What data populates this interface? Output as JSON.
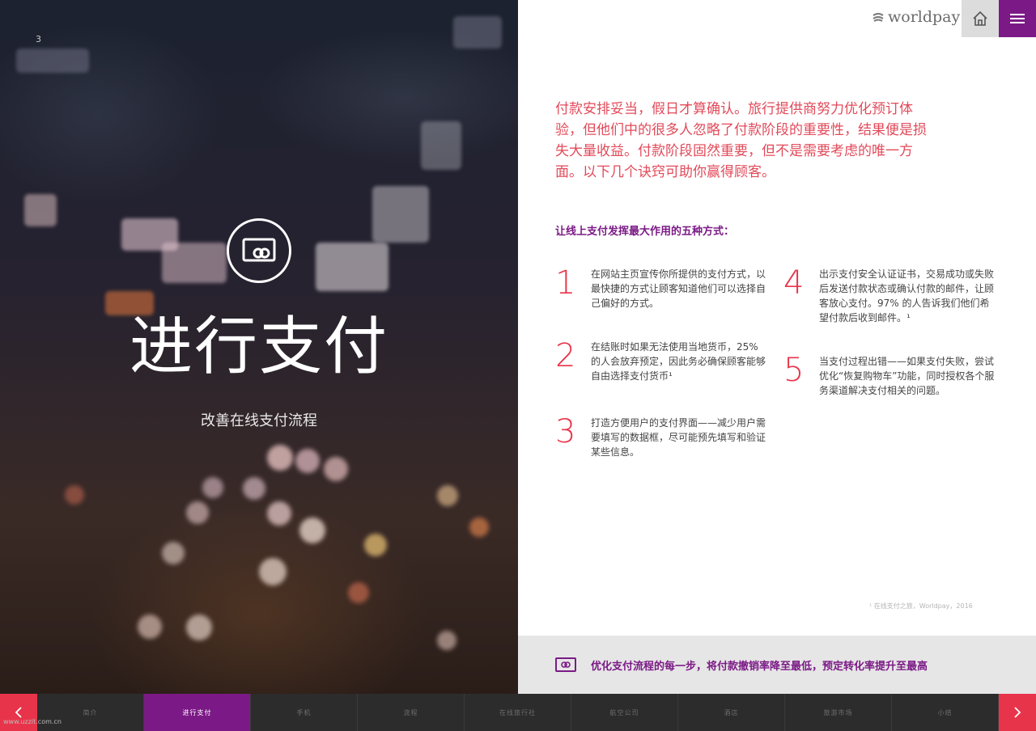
{
  "left_panel": {
    "page_number": "3",
    "hero_title": "进行支付",
    "hero_subtitle": "改善在线支付流程",
    "hero_icon": "payment-card-icon"
  },
  "header": {
    "logo_text": "worldpay",
    "home_icon": "home-icon",
    "menu_icon": "hamburger-menu-icon"
  },
  "content": {
    "intro": "付款安排妥当，假日才算确认。旅行提供商努力优化预订体验，但他们中的很多人忽略了付款阶段的重要性，结果便是损失大量收益。付款阶段固然重要，但不是需要考虑的唯一方面。以下几个诀窍可助你赢得顾客。",
    "subhead": "让线上支付发挥最大作用的五种方式：",
    "tips": [
      {
        "num": "1",
        "text": "在网站主页宣传你所提供的支付方式，以最快捷的方式让顾客知道他们可以选择自己偏好的方式。"
      },
      {
        "num": "2",
        "text": "在结账时如果无法使用当地货币，25% 的人会放弃预定，因此务必确保顾客能够自由选择支付货币¹"
      },
      {
        "num": "3",
        "text": "打造方便用户的支付界面——减少用户需要填写的数据框，尽可能预先填写和验证某些信息。"
      },
      {
        "num": "4",
        "text": "出示支付安全认证证书，交易成功或失败后发送付款状态或确认付款的邮件，让顾客放心支付。97% 的人告诉我们他们希望付款后收到邮件。¹"
      },
      {
        "num": "5",
        "text": "当支付过程出错——如果支付失败，尝试优化“恢复购物车”功能，同时授权各个服务渠道解决支付相关的问题。"
      }
    ],
    "footnote": "¹ 在线支付之旅，Worldpay，2016",
    "banner_text": "优化支付流程的每一步，将付款撤销率降至最低，预定转化率提升至最高"
  },
  "nav": {
    "prev_icon": "chevron-left-icon",
    "next_icon": "chevron-right-icon",
    "tabs": [
      "简介",
      "进行支付",
      "手机",
      "流程",
      "在线旅行社",
      "航空公司",
      "酒店",
      "旅游市场",
      "小结"
    ],
    "active_index": 1
  },
  "watermark": "www.uzzit.com.cn",
  "colors": {
    "brand_purple": "#7b1a86",
    "accent_red": "#e8344a",
    "intro_red": "#e24a5a"
  }
}
